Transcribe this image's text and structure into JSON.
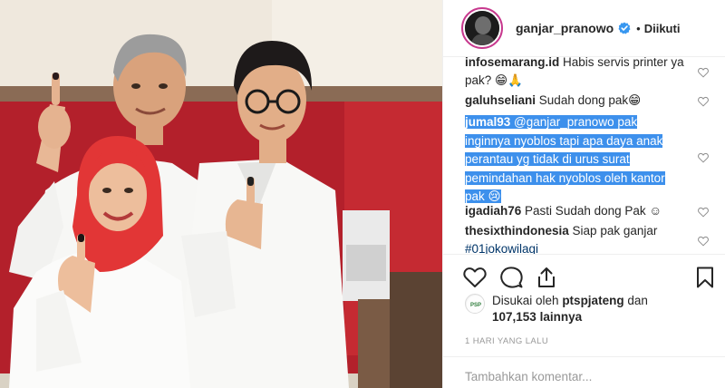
{
  "header": {
    "username": "ganjar_pranowo",
    "separator": "•",
    "follow_state": "Diikuti"
  },
  "comments": [
    {
      "user": "infosemarang.id",
      "text": "Habis servis printer ya pak? 😁🙏"
    },
    {
      "user": "galuhseliani",
      "text": "Sudah dong pak😁"
    },
    {
      "user": "jumal93",
      "lines": [
        "@ganjar_pranowo pak",
        "inginnya nyoblos tapi apa daya anak",
        "perantau yg tidak di urus surat",
        "pemindahan hak nyoblos oleh kantor",
        "pak 😢"
      ],
      "highlighted": true
    },
    {
      "user": "igadiah76",
      "text": "Pasti Sudah dong Pak ☺"
    },
    {
      "user": "thesixthindonesia",
      "text": "Siap pak ganjar",
      "line2": "#01jokowilagi"
    }
  ],
  "likes": {
    "prefix": "Disukai oleh",
    "first_liker": "ptspjateng",
    "conjunction": "dan",
    "count": "107,153",
    "suffix": "lainnya",
    "avatar_text": "PSP"
  },
  "timestamp": "1 HARI YANG LALU",
  "add_comment_placeholder": "Tambahkan komentar...",
  "icons": {
    "verified": "verified-badge-icon",
    "like": "heart-icon",
    "comment": "comment-bubble-icon",
    "share": "share-icon",
    "save": "bookmark-icon"
  },
  "colors": {
    "verified_blue": "#3897f0",
    "selection_highlight": "#3d90ec",
    "muted_text": "#999999",
    "avatar_ring": "#c7398e"
  }
}
